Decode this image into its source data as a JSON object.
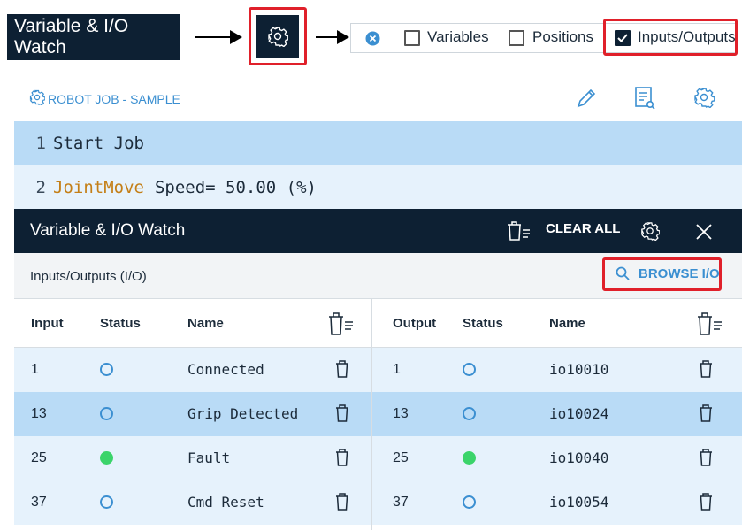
{
  "annotation": {
    "label": "Variable & I/O Watch",
    "filters": [
      {
        "label": "Variables",
        "checked": false
      },
      {
        "label": "Positions",
        "checked": false
      },
      {
        "label": "Inputs/Outputs",
        "checked": true
      }
    ]
  },
  "job": {
    "title": "ROBOT JOB - SAMPLE",
    "lines": [
      {
        "num": "1",
        "keyword": "",
        "text": "Start Job"
      },
      {
        "num": "2",
        "keyword": "JointMove",
        "text": "Speed= 50.00 (%)"
      }
    ]
  },
  "watch": {
    "title": "Variable & I/O Watch",
    "clear_all": "CLEAR ALL",
    "section_title": "Inputs/Outputs (I/O)",
    "browse_label": "BROWSE I/O"
  },
  "table": {
    "input_headers": {
      "col1": "Input",
      "col2": "Status",
      "col3": "Name"
    },
    "output_headers": {
      "col1": "Output",
      "col2": "Status",
      "col3": "Name"
    },
    "rows": [
      {
        "in_num": "1",
        "in_status": "off",
        "in_name": "Connected",
        "out_num": "1",
        "out_status": "off",
        "out_name": "io10010"
      },
      {
        "in_num": "13",
        "in_status": "off",
        "in_name": "Grip Detected",
        "out_num": "13",
        "out_status": "off",
        "out_name": "io10024"
      },
      {
        "in_num": "25",
        "in_status": "on",
        "in_name": "Fault",
        "out_num": "25",
        "out_status": "on",
        "out_name": "io10040"
      },
      {
        "in_num": "37",
        "in_status": "off",
        "in_name": "Cmd Reset",
        "out_num": "37",
        "out_status": "off",
        "out_name": "io10054"
      }
    ]
  },
  "colors": {
    "navy": "#0d2033",
    "accent_blue": "#3b8fd1",
    "highlight_red": "#e0202a",
    "status_on": "#3bd46a",
    "row_selected": "#b9dbf6",
    "row_alt": "#e6f2fc",
    "keyword_orange": "#c47f17"
  }
}
